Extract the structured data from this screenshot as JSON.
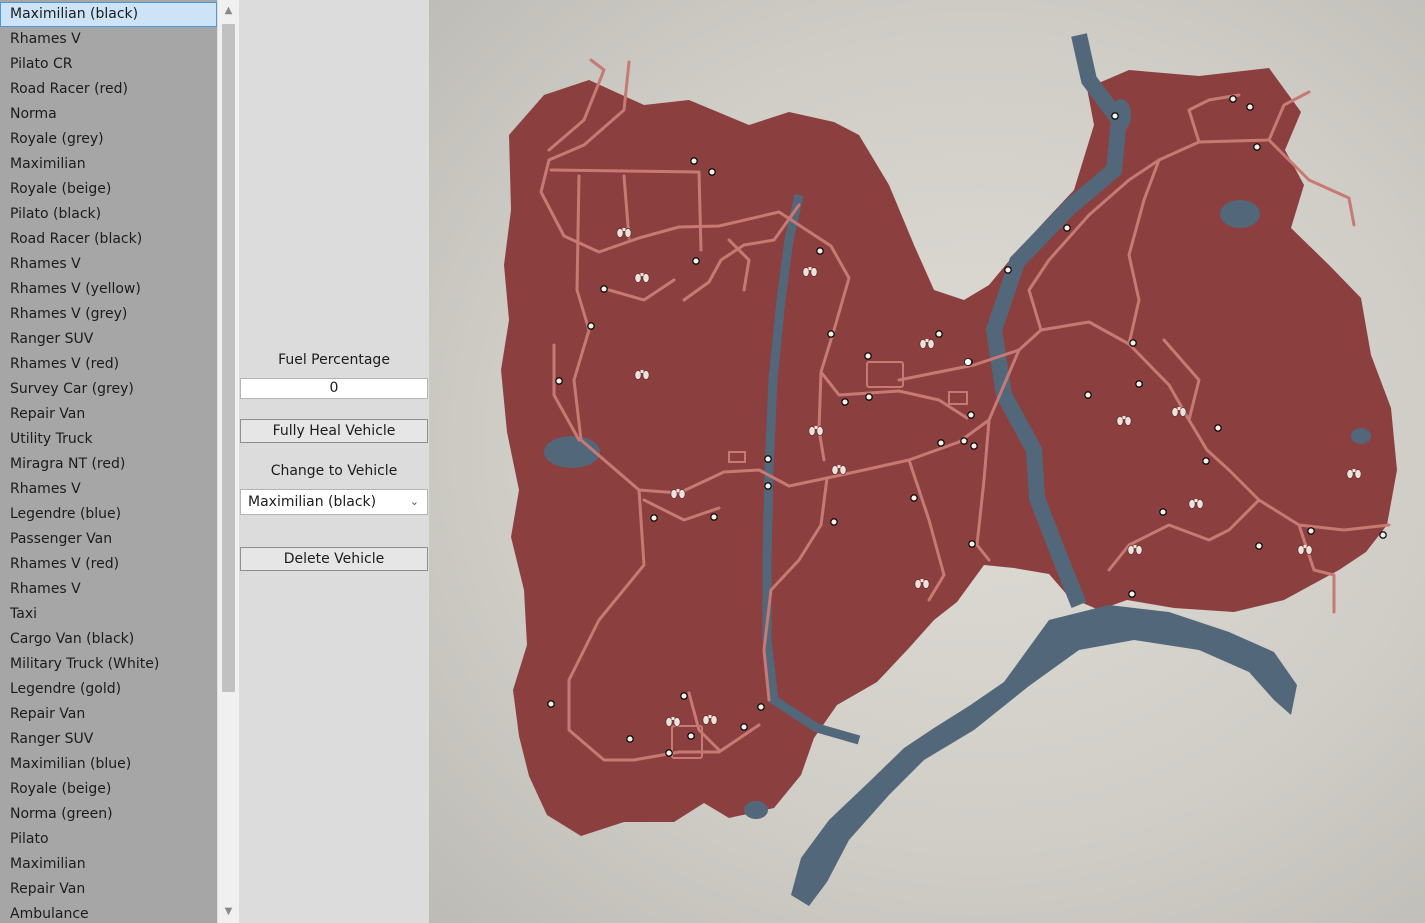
{
  "vehicle_list": {
    "items": [
      "Maximilian (black)",
      "Rhames V",
      "Pilato CR",
      "Road Racer (red)",
      "Norma",
      "Royale (grey)",
      "Maximilian",
      "Royale (beige)",
      "Pilato (black)",
      "Road Racer (black)",
      "Rhames V",
      "Rhames V (yellow)",
      "Rhames V (grey)",
      "Ranger SUV",
      "Rhames V (red)",
      "Survey Car (grey)",
      "Repair Van",
      "Utility Truck",
      "Miragra NT (red)",
      "Rhames V",
      "Legendre (blue)",
      "Passenger Van",
      "Rhames V (red)",
      "Rhames V",
      "Taxi",
      "Cargo Van (black)",
      "Military Truck (White)",
      "Legendre (gold)",
      "Repair Van",
      "Ranger SUV",
      "Maximilian (blue)",
      "Royale (beige)",
      "Norma (green)",
      "Pilato",
      "Maximilian",
      "Repair Van",
      "Ambulance"
    ],
    "selected_index": 0,
    "scroll_up_icon": "chevron-up-icon",
    "scroll_down_icon": "chevron-down-icon"
  },
  "controls": {
    "fuel_label": "Fuel Percentage",
    "fuel_value": "0",
    "heal_button": "Fully Heal Vehicle",
    "change_label": "Change to Vehicle",
    "change_selected": "Maximilian (black)",
    "delete_button": "Delete Vehicle"
  },
  "map": {
    "land_color": "#8c3f3f",
    "water_color": "#53677a",
    "road_color": "#c77a74",
    "background_color": "#d6d4cd",
    "marker_icon": "vehicle-marker-icon",
    "binocular_icon": "binoculars-icon"
  }
}
